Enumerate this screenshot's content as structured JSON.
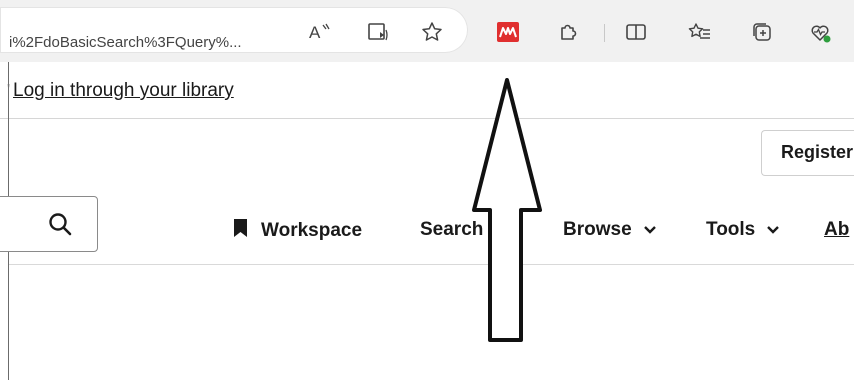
{
  "browser": {
    "url": "i%2FdoBasicSearch%3FQuery%...",
    "icons": [
      "read-aloud-icon",
      "immersive-reader-icon",
      "favorite-star-icon",
      "mendeley-extension-icon",
      "extensions-puzzle-icon",
      "split-screen-icon",
      "favorites-list-icon",
      "collections-icon",
      "browser-essentials-icon"
    ],
    "read_aloud_glyph": "Aᴬ"
  },
  "login": {
    "prefix": "'",
    "link": "Log in through your library"
  },
  "header": {
    "register": "Register"
  },
  "nav": {
    "workspace": "Workspace",
    "search": "Search",
    "browse": "Browse",
    "tools": "Tools",
    "about": "Ab"
  },
  "colors": {
    "mendeley_red": "#e02f2f",
    "arrow_stroke": "#111111"
  }
}
